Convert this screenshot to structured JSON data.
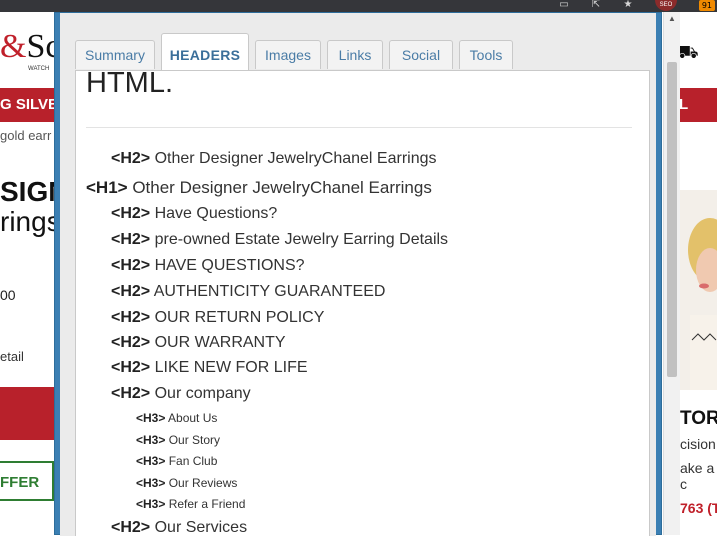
{
  "browser": {
    "extension_badge": "91",
    "seo_icon_label": "SEO"
  },
  "site": {
    "logo_initial": "&",
    "logo_rest": "Sc",
    "logo_sub": "WATCH",
    "nav_left": "G SILVE",
    "nav_right": "L",
    "breadcrumb": "gold earr",
    "heading_fragment_1": "SIGN",
    "heading_fragment_2": "rings",
    "price_fragment": "00",
    "detail_fragment": "etail",
    "offer_fragment": "FFER",
    "side_heading": "TOR",
    "side_text_1": "cision",
    "side_text_2": "ake a c",
    "side_phone": "763 (T"
  },
  "popup": {
    "tabs": [
      {
        "label": "Summary",
        "active": false
      },
      {
        "label": "HEADERS",
        "active": true
      },
      {
        "label": "Images",
        "active": false
      },
      {
        "label": "Links",
        "active": false
      },
      {
        "label": "Social",
        "active": false
      },
      {
        "label": "Tools",
        "active": false
      }
    ],
    "section_title": "HTML.",
    "headers": [
      {
        "level": 2,
        "tag": "<H2>",
        "text": "Other Designer JewelryChanel Earrings"
      },
      {
        "level": 1,
        "tag": "<H1>",
        "text": "Other Designer JewelryChanel Earrings"
      },
      {
        "level": 2,
        "tag": "<H2>",
        "text": "Have Questions?"
      },
      {
        "level": 2,
        "tag": "<H2>",
        "text": "pre-owned Estate Jewelry Earring Details"
      },
      {
        "level": 2,
        "tag": "<H2>",
        "text": "HAVE QUESTIONS?"
      },
      {
        "level": 2,
        "tag": "<H2>",
        "text": "AUTHENTICITY GUARANTEED"
      },
      {
        "level": 2,
        "tag": "<H2>",
        "text": "OUR RETURN POLICY"
      },
      {
        "level": 2,
        "tag": "<H2>",
        "text": "OUR WARRANTY"
      },
      {
        "level": 2,
        "tag": "<H2>",
        "text": "LIKE NEW FOR LIFE"
      },
      {
        "level": 2,
        "tag": "<H2>",
        "text": "Our company"
      },
      {
        "level": 3,
        "tag": "<H3>",
        "text": "About Us"
      },
      {
        "level": 3,
        "tag": "<H3>",
        "text": "Our Story"
      },
      {
        "level": 3,
        "tag": "<H3>",
        "text": "Fan Club"
      },
      {
        "level": 3,
        "tag": "<H3>",
        "text": "Our Reviews"
      },
      {
        "level": 3,
        "tag": "<H3>",
        "text": "Refer a Friend"
      },
      {
        "level": 2,
        "tag": "<H2>",
        "text": "Our Services"
      }
    ]
  },
  "colors": {
    "popup_border": "#3b7fb3",
    "tab_text": "#4a7ca6",
    "brand_red": "#b8212b",
    "offer_green": "#2e7d32"
  }
}
